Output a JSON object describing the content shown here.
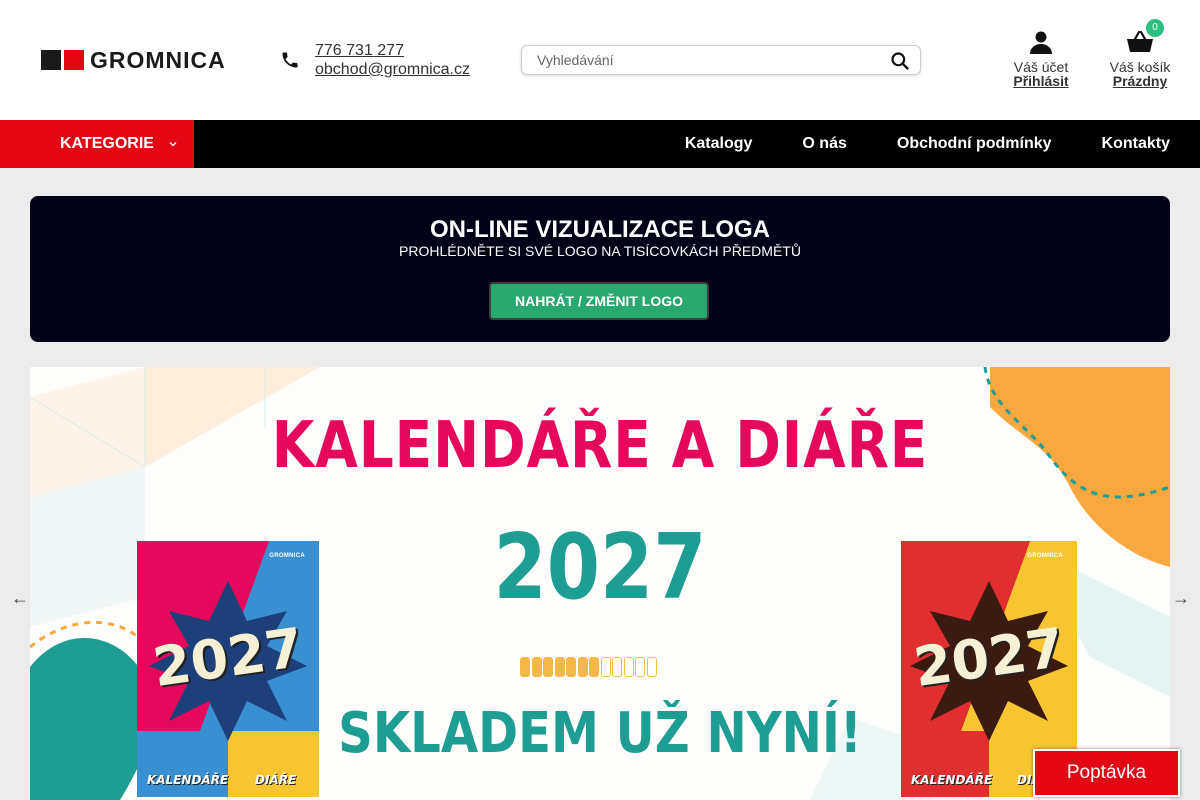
{
  "brand": {
    "name": "GROMNICA",
    "red": "#e30613",
    "green": "#27a96f",
    "teal": "#1e9e93",
    "pink": "#e5085c"
  },
  "contact": {
    "phone": "776 731 277",
    "email": "obchod@gromnica.cz",
    "icon": "phone-icon"
  },
  "search": {
    "placeholder": "Vyhledávání",
    "value": "",
    "icon": "search-icon"
  },
  "account": {
    "label": "Váš účet",
    "action": "Přihlásit",
    "icon": "user-icon"
  },
  "cart": {
    "label": "Váš košík",
    "status": "Prázdny",
    "count": "0",
    "icon": "basket-icon"
  },
  "nav": {
    "categories_label": "KATEGORIE",
    "links": [
      "Katalogy",
      "O nás",
      "Obchodní podmínky",
      "Kontakty"
    ]
  },
  "promo": {
    "title": "ON-LINE VIZUALIZACE LOGA",
    "subtitle": "PROHLÉDNĚTE SI SVÉ LOGO NA TISÍCOVKÁCH PŘEDMĚTŮ",
    "button": "NAHRÁT / ZMĚNIT LOGO"
  },
  "banner": {
    "title": "KALENDÁŘE A DIÁŘE",
    "year": "2027",
    "stock": "SKLADEM UŽ NYNÍ!",
    "progress_filled": 7,
    "progress_total": 12,
    "books": [
      {
        "year": "2027",
        "label_left": "KALENDÁŘE",
        "label_right": "DIÁŘE",
        "brand": "GROMNICA"
      },
      {
        "year": "2027",
        "label_left": "KALENDÁŘE",
        "label_right": "DIÁŘE",
        "brand": "GROMNICA"
      }
    ]
  },
  "carousel": {
    "prev": "←",
    "next": "→"
  },
  "inquiry_button": "Poptávka"
}
